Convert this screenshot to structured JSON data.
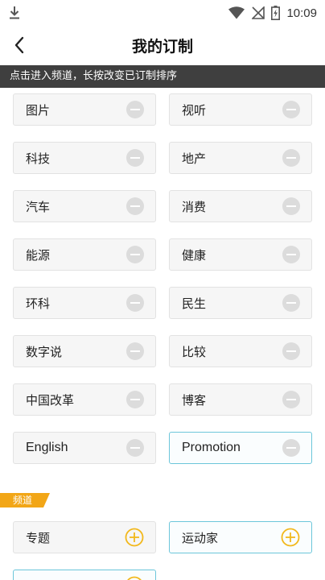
{
  "status_bar": {
    "time": "10:09",
    "icons": [
      "download-icon",
      "wifi-icon",
      "no-signal-icon",
      "battery-icon"
    ]
  },
  "header": {
    "title": "我的订制",
    "back_icon": "chevron-left-icon"
  },
  "hint": "点击进入频道，长按改变已订制排序",
  "subscribed": [
    {
      "label": "图片",
      "action": "remove"
    },
    {
      "label": "视听",
      "action": "remove"
    },
    {
      "label": "科技",
      "action": "remove"
    },
    {
      "label": "地产",
      "action": "remove"
    },
    {
      "label": "汽车",
      "action": "remove"
    },
    {
      "label": "消费",
      "action": "remove"
    },
    {
      "label": "能源",
      "action": "remove"
    },
    {
      "label": "健康",
      "action": "remove"
    },
    {
      "label": "环科",
      "action": "remove"
    },
    {
      "label": "民生",
      "action": "remove"
    },
    {
      "label": "数字说",
      "action": "remove"
    },
    {
      "label": "比较",
      "action": "remove"
    },
    {
      "label": "中国改革",
      "action": "remove"
    },
    {
      "label": "博客",
      "action": "remove"
    },
    {
      "label": "English",
      "action": "remove"
    },
    {
      "label": "Promotion",
      "action": "remove",
      "highlighted": true
    }
  ],
  "available_section": {
    "label": "频道"
  },
  "available": [
    {
      "label": "专题",
      "action": "add"
    },
    {
      "label": "运动家",
      "action": "add",
      "highlighted": true
    },
    {
      "label": "",
      "action": "add",
      "highlighted": true
    }
  ],
  "colors": {
    "hint_bar": "#3f3f3f",
    "section_tag": "#f2a617",
    "add_icon": "#f2b81c",
    "remove_icon": "#dcdcdc",
    "highlight_border": "#6cc6da"
  }
}
